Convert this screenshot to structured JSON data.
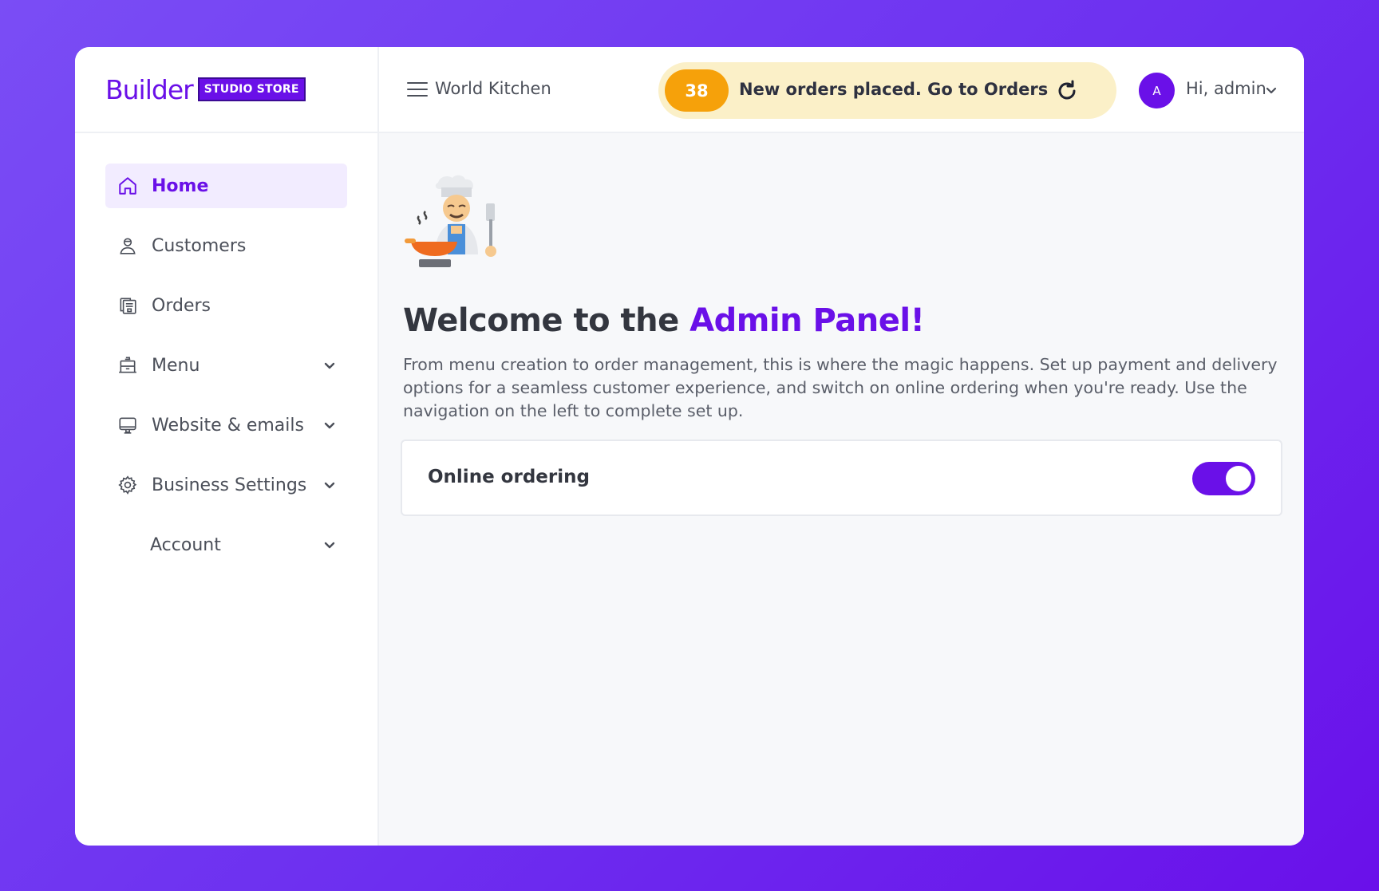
{
  "brand": {
    "logo_word": "Builder",
    "logo_badge": "STUDIO STORE"
  },
  "sidebar": {
    "items": [
      {
        "label": "Home",
        "icon": "home-icon",
        "active": true,
        "expandable": false
      },
      {
        "label": "Customers",
        "icon": "user-icon",
        "active": false,
        "expandable": false
      },
      {
        "label": "Orders",
        "icon": "orders-icon",
        "active": false,
        "expandable": false
      },
      {
        "label": "Menu",
        "icon": "menu-book-icon",
        "active": false,
        "expandable": true
      },
      {
        "label": "Website & emails",
        "icon": "monitor-icon",
        "active": false,
        "expandable": true
      },
      {
        "label": "Business Settings",
        "icon": "gear-icon",
        "active": false,
        "expandable": true
      },
      {
        "label": "Account",
        "icon": "",
        "active": false,
        "expandable": true
      }
    ]
  },
  "header": {
    "store_name": "World Kitchen",
    "alert": {
      "count": "38",
      "text": "New orders placed. Go to Orders"
    },
    "user": {
      "avatar_initial": "A",
      "greeting": "Hi, admin"
    }
  },
  "main": {
    "welcome_prefix": "Welcome to the ",
    "welcome_accent": "Admin Panel!",
    "description": "From menu creation to order management, this is where the magic happens. Set up payment and delivery options for a seamless customer experience, and switch on online ordering when you're ready. Use the navigation on the left to complete set up.",
    "online_ordering": {
      "label": "Online ordering",
      "enabled": true
    }
  },
  "colors": {
    "accent": "#6a10e8",
    "alert_bg": "#fbf0c8",
    "badge": "#f6a10a"
  }
}
